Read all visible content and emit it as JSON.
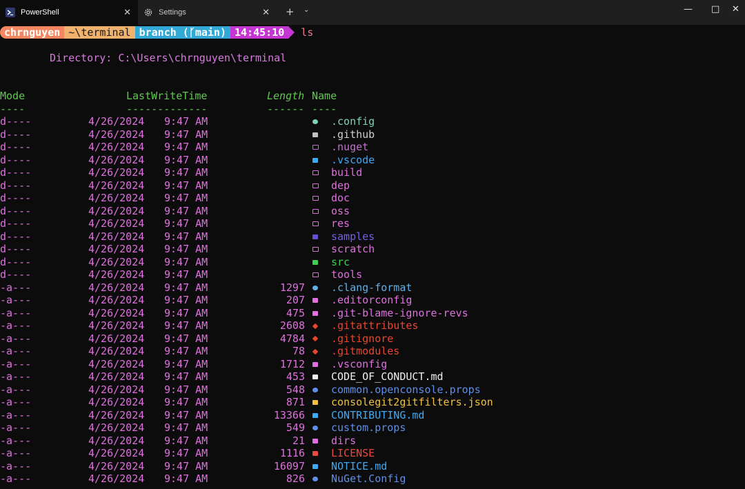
{
  "tabs": [
    {
      "label": "PowerShell",
      "icon": "powershell-icon",
      "active": true
    },
    {
      "label": "Settings",
      "icon": "gear-icon",
      "active": false
    }
  ],
  "window_controls": {
    "minimize": "—",
    "maximize": "□",
    "close": "✕",
    "new_tab": "+",
    "tab_menu": "⌄"
  },
  "prompt": {
    "user": "chrnguyen",
    "path": "~\\terminal",
    "branch": "branch (ᚴmain)",
    "time": "14:45:10",
    "command": "ls"
  },
  "listing": {
    "directory_line": "Directory: C:\\Users\\chrnguyen\\terminal",
    "headers": {
      "mode": "Mode",
      "lastwritetime": "LastWriteTime",
      "length": "Length",
      "name": "Name"
    },
    "underlines": {
      "mode": "----",
      "lastwritetime": "-------------",
      "length": "------",
      "name": "----"
    },
    "entries": [
      {
        "mode": "d----",
        "date": "4/26/2024",
        "time": "9:47 AM",
        "length": "",
        "name": ".config",
        "icon": "gear-icon",
        "icon_color": "#7fd3b8",
        "name_color": "#7fd3b8"
      },
      {
        "mode": "d----",
        "date": "4/26/2024",
        "time": "9:47 AM",
        "length": "",
        "name": ".github",
        "icon": "folder-filled-icon",
        "icon_color": "#c0c0c0",
        "name_color": "#d0d0d0"
      },
      {
        "mode": "d----",
        "date": "4/26/2024",
        "time": "9:47 AM",
        "length": "",
        "name": ".nuget",
        "icon": "folder-icon",
        "icon_color": "#c06fd0",
        "name_color": "#c06fd0"
      },
      {
        "mode": "d----",
        "date": "4/26/2024",
        "time": "9:47 AM",
        "length": "",
        "name": ".vscode",
        "icon": "vscode-folder-icon",
        "icon_color": "#3fa9f5",
        "name_color": "#3fa9f5"
      },
      {
        "mode": "d----",
        "date": "4/26/2024",
        "time": "9:47 AM",
        "length": "",
        "name": "build",
        "icon": "folder-icon",
        "icon_color": "#e070e0",
        "name_color": "#e070e0"
      },
      {
        "mode": "d----",
        "date": "4/26/2024",
        "time": "9:47 AM",
        "length": "",
        "name": "dep",
        "icon": "folder-icon",
        "icon_color": "#e070e0",
        "name_color": "#e070e0"
      },
      {
        "mode": "d----",
        "date": "4/26/2024",
        "time": "9:47 AM",
        "length": "",
        "name": "doc",
        "icon": "folder-icon",
        "icon_color": "#e070e0",
        "name_color": "#e070e0"
      },
      {
        "mode": "d----",
        "date": "4/26/2024",
        "time": "9:47 AM",
        "length": "",
        "name": "oss",
        "icon": "folder-icon",
        "icon_color": "#e070e0",
        "name_color": "#e070e0"
      },
      {
        "mode": "d----",
        "date": "4/26/2024",
        "time": "9:47 AM",
        "length": "",
        "name": "res",
        "icon": "folder-icon",
        "icon_color": "#e070e0",
        "name_color": "#e070e0"
      },
      {
        "mode": "d----",
        "date": "4/26/2024",
        "time": "9:47 AM",
        "length": "",
        "name": "samples",
        "icon": "folder-filled-icon",
        "icon_color": "#6a4fd0",
        "name_color": "#7a5fe0"
      },
      {
        "mode": "d----",
        "date": "4/26/2024",
        "time": "9:47 AM",
        "length": "",
        "name": "scratch",
        "icon": "folder-icon",
        "icon_color": "#e070e0",
        "name_color": "#e070e0"
      },
      {
        "mode": "d----",
        "date": "4/26/2024",
        "time": "9:47 AM",
        "length": "",
        "name": "src",
        "icon": "src-folder-icon",
        "icon_color": "#3fd04f",
        "name_color": "#3fd04f"
      },
      {
        "mode": "d----",
        "date": "4/26/2024",
        "time": "9:47 AM",
        "length": "",
        "name": "tools",
        "icon": "folder-icon",
        "icon_color": "#e070e0",
        "name_color": "#e070e0"
      },
      {
        "mode": "-a---",
        "date": "4/26/2024",
        "time": "9:47 AM",
        "length": "1297",
        "name": ".clang-format",
        "icon": "gear-icon",
        "icon_color": "#5fb0e8",
        "name_color": "#5fb0e8"
      },
      {
        "mode": "-a---",
        "date": "4/26/2024",
        "time": "9:47 AM",
        "length": "207",
        "name": ".editorconfig",
        "icon": "file-icon",
        "icon_color": "#e070e0",
        "name_color": "#e070e0"
      },
      {
        "mode": "-a---",
        "date": "4/26/2024",
        "time": "9:47 AM",
        "length": "475",
        "name": ".git-blame-ignore-revs",
        "icon": "file-icon",
        "icon_color": "#e070e0",
        "name_color": "#e070e0"
      },
      {
        "mode": "-a---",
        "date": "4/26/2024",
        "time": "9:47 AM",
        "length": "2608",
        "name": ".gitattributes",
        "icon": "git-icon",
        "icon_color": "#e8472f",
        "name_color": "#e8472f"
      },
      {
        "mode": "-a---",
        "date": "4/26/2024",
        "time": "9:47 AM",
        "length": "4784",
        "name": ".gitignore",
        "icon": "git-icon",
        "icon_color": "#e8472f",
        "name_color": "#e8472f"
      },
      {
        "mode": "-a---",
        "date": "4/26/2024",
        "time": "9:47 AM",
        "length": "78",
        "name": ".gitmodules",
        "icon": "git-icon",
        "icon_color": "#e8472f",
        "name_color": "#e8472f"
      },
      {
        "mode": "-a---",
        "date": "4/26/2024",
        "time": "9:47 AM",
        "length": "1712",
        "name": ".vsconfig",
        "icon": "file-icon",
        "icon_color": "#e070e0",
        "name_color": "#e070e0"
      },
      {
        "mode": "-a---",
        "date": "4/26/2024",
        "time": "9:47 AM",
        "length": "453",
        "name": "CODE_OF_CONDUCT.md",
        "icon": "handshake-icon",
        "icon_color": "#f0f0f0",
        "name_color": "#f0f0f0"
      },
      {
        "mode": "-a---",
        "date": "4/26/2024",
        "time": "9:47 AM",
        "length": "548",
        "name": "common.openconsole.props",
        "icon": "gear-icon",
        "icon_color": "#5f8fe8",
        "name_color": "#5f8fe8"
      },
      {
        "mode": "-a---",
        "date": "4/26/2024",
        "time": "9:47 AM",
        "length": "871",
        "name": "consolegit2gitfilters.json",
        "icon": "json-icon",
        "icon_color": "#f0c040",
        "name_color": "#f0c040"
      },
      {
        "mode": "-a---",
        "date": "4/26/2024",
        "time": "9:47 AM",
        "length": "13366",
        "name": "CONTRIBUTING.md",
        "icon": "markdown-icon",
        "icon_color": "#3fa9f5",
        "name_color": "#3fa9f5"
      },
      {
        "mode": "-a---",
        "date": "4/26/2024",
        "time": "9:47 AM",
        "length": "549",
        "name": "custom.props",
        "icon": "gear-icon",
        "icon_color": "#5f8fe8",
        "name_color": "#5f8fe8"
      },
      {
        "mode": "-a---",
        "date": "4/26/2024",
        "time": "9:47 AM",
        "length": "21",
        "name": "dirs",
        "icon": "file-icon",
        "icon_color": "#e070e0",
        "name_color": "#e070e0"
      },
      {
        "mode": "-a---",
        "date": "4/26/2024",
        "time": "9:47 AM",
        "length": "1116",
        "name": "LICENSE",
        "icon": "license-icon",
        "icon_color": "#e84a3f",
        "name_color": "#e84a3f"
      },
      {
        "mode": "-a---",
        "date": "4/26/2024",
        "time": "9:47 AM",
        "length": "16097",
        "name": "NOTICE.md",
        "icon": "markdown-icon",
        "icon_color": "#3fa9f5",
        "name_color": "#3fa9f5"
      },
      {
        "mode": "-a---",
        "date": "4/26/2024",
        "time": "9:47 AM",
        "length": "826",
        "name": "NuGet.Config",
        "icon": "gear-icon",
        "icon_color": "#5f8fe8",
        "name_color": "#5f8fe8"
      }
    ]
  }
}
